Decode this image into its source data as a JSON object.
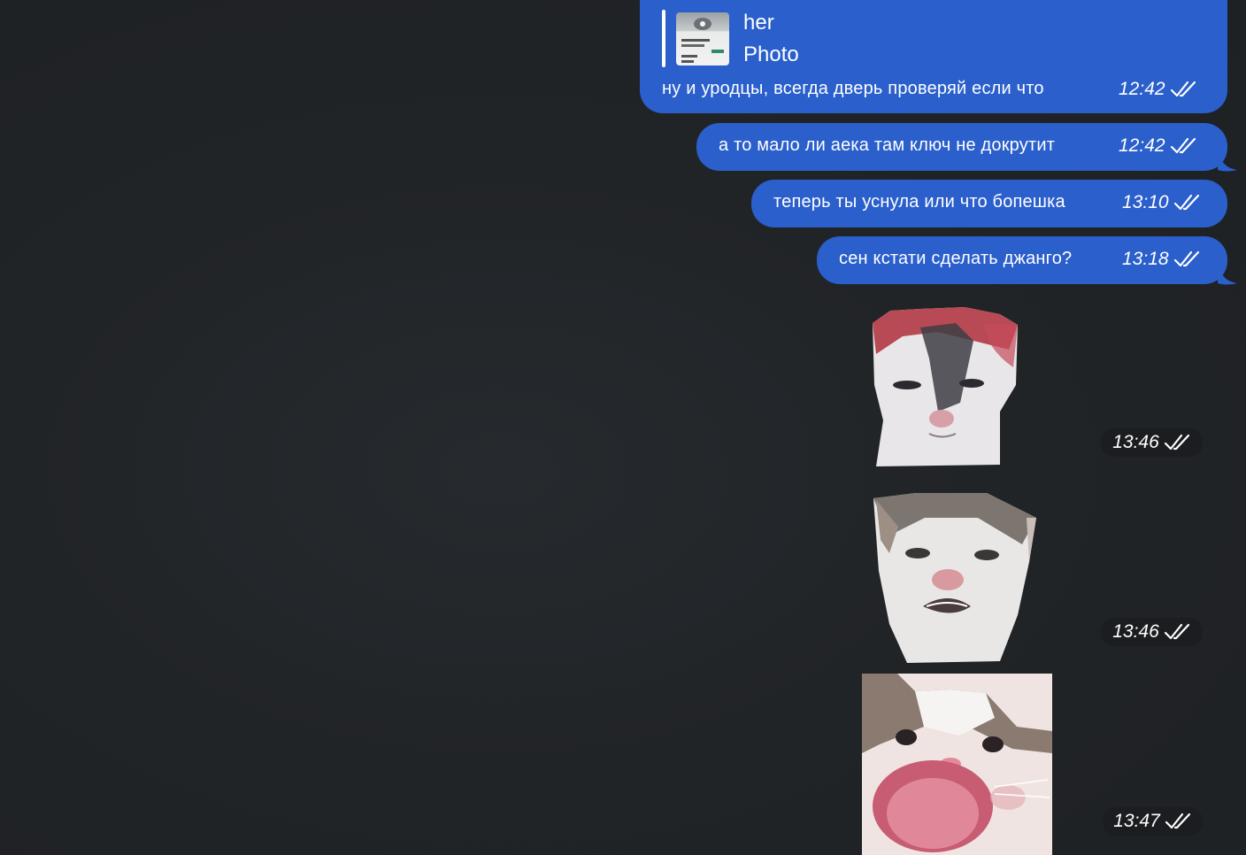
{
  "messages": [
    {
      "reply": {
        "author": "her",
        "preview": "Photo"
      },
      "text": "ну и уродцы, всегда дверь проверяй если что",
      "time": "12:42",
      "status_icon": "double-check-icon"
    },
    {
      "text": "а то мало ли аека там ключ не докрутит",
      "time": "12:42",
      "status_icon": "double-check-icon"
    },
    {
      "text": "теперь ты уснула или что бопешка",
      "time": "13:10",
      "status_icon": "double-check-icon"
    },
    {
      "text": "сен кстати сделать джанго?",
      "time": "13:18",
      "status_icon": "double-check-icon"
    }
  ],
  "stickers": [
    {
      "description": "cat-sticker-squinting",
      "time": "13:46",
      "status_icon": "double-check-icon"
    },
    {
      "description": "cat-sticker-pouting",
      "time": "13:46",
      "status_icon": "double-check-icon"
    },
    {
      "description": "cat-sticker-screaming",
      "time": "13:47",
      "status_icon": "double-check-icon"
    }
  ],
  "colors": {
    "background": "#212427",
    "outgoing_bubble": "#2a5fcc",
    "timestamp_pill": "#1b1d20",
    "text": "#ffffff"
  }
}
